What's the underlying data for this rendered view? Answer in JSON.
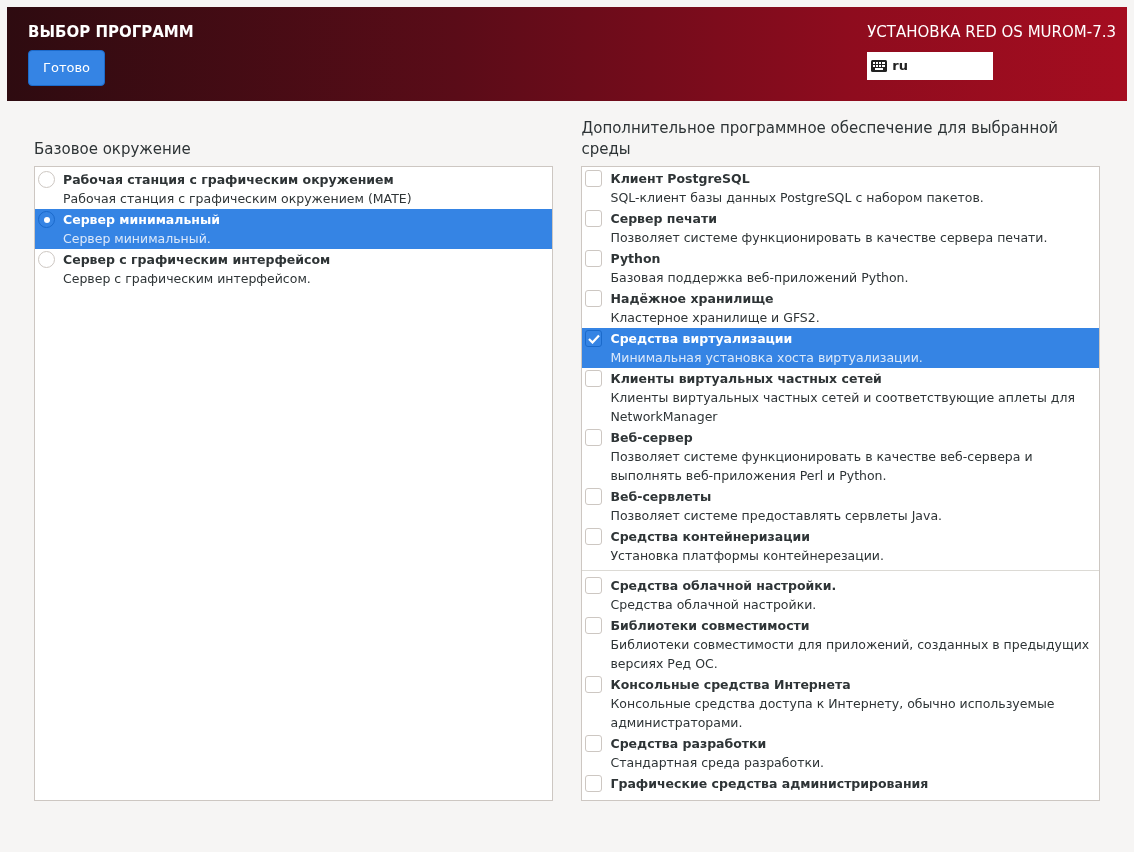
{
  "header": {
    "title": "ВЫБОР ПРОГРАММ",
    "done_button": "Готово",
    "product": "УСТАНОВКА RED OS MUROM-7.3",
    "keyboard_layout": "ru"
  },
  "base_environment": {
    "heading": "Базовое окружение",
    "items": [
      {
        "name": "Рабочая станция с графическим окружением",
        "description": "Рабочая станция с графическим окружением (MATE)",
        "selected": false
      },
      {
        "name": "Сервер минимальный",
        "description": "Сервер минимальный.",
        "selected": true
      },
      {
        "name": "Сервер с графическим интерфейсом",
        "description": "Сервер с графическим интерфейсом.",
        "selected": false
      }
    ]
  },
  "addons": {
    "heading": "Дополнительное программное обеспечение для выбранной среды",
    "groups": [
      [
        {
          "name": "Клиент PostgreSQL",
          "description": "SQL-клиент базы данных PostgreSQL с набором пакетов.",
          "checked": false,
          "selected": false
        },
        {
          "name": "Сервер печати",
          "description": "Позволяет системе функционировать в качестве сервера печати.",
          "checked": false,
          "selected": false
        },
        {
          "name": "Python",
          "description": "Базовая поддержка веб-приложений Python.",
          "checked": false,
          "selected": false
        },
        {
          "name": "Надёжное хранилище",
          "description": "Кластерное хранилище и GFS2.",
          "checked": false,
          "selected": false
        },
        {
          "name": "Средства виртуализации",
          "description": "Минимальная установка хоста виртуализации.",
          "checked": true,
          "selected": true
        },
        {
          "name": "Клиенты виртуальных частных сетей",
          "description": "Клиенты виртуальных частных сетей и соответствующие аплеты для NetworkManager",
          "checked": false,
          "selected": false
        },
        {
          "name": "Веб-сервер",
          "description": "Позволяет системе функционировать в качестве веб-сервера и выполнять веб-приложения Perl и Python.",
          "checked": false,
          "selected": false
        },
        {
          "name": "Веб-сервлеты",
          "description": "Позволяет системе предоставлять сервлеты Java.",
          "checked": false,
          "selected": false
        },
        {
          "name": "Средства контейнеризации",
          "description": "Установка платформы контейнерезации.",
          "checked": false,
          "selected": false
        }
      ],
      [
        {
          "name": "Средства облачной настройки.",
          "description": "Средства облачной настройки.",
          "checked": false,
          "selected": false
        },
        {
          "name": "Библиотеки совместимости",
          "description": "Библиотеки совместимости для приложений, созданных в предыдущих версиях Ред ОС.",
          "checked": false,
          "selected": false
        },
        {
          "name": "Консольные средства Интернета",
          "description": "Консольные средства доступа к Интернету, обычно используемые администраторами.",
          "checked": false,
          "selected": false
        },
        {
          "name": "Средства разработки",
          "description": "Стандартная среда разработки.",
          "checked": false,
          "selected": false
        },
        {
          "name": "Графические средства администрирования",
          "checked": false,
          "selected": false
        }
      ]
    ]
  }
}
